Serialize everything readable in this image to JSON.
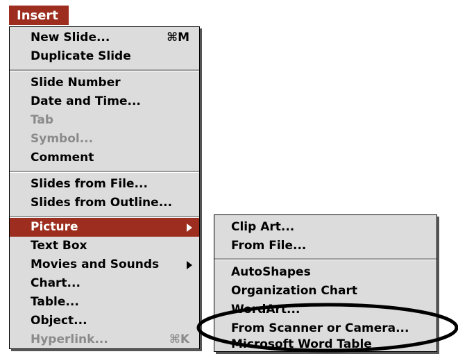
{
  "menubar": {
    "title": "Insert"
  },
  "main_menu": {
    "items": [
      {
        "label": "New Slide...",
        "shortcut": "⌘M",
        "state": "enabled"
      },
      {
        "label": "Duplicate Slide",
        "state": "enabled"
      },
      {
        "label": "Slide Number",
        "state": "enabled"
      },
      {
        "label": "Date and Time...",
        "state": "enabled"
      },
      {
        "label": "Tab",
        "state": "disabled"
      },
      {
        "label": "Symbol...",
        "state": "disabled"
      },
      {
        "label": "Comment",
        "state": "enabled"
      },
      {
        "label": "Slides from File...",
        "state": "enabled"
      },
      {
        "label": "Slides from Outline...",
        "state": "enabled"
      },
      {
        "label": "Picture",
        "state": "selected",
        "submenu": true
      },
      {
        "label": "Text Box",
        "state": "enabled"
      },
      {
        "label": "Movies and Sounds",
        "state": "enabled",
        "submenu": true
      },
      {
        "label": "Chart...",
        "state": "enabled"
      },
      {
        "label": "Table...",
        "state": "enabled"
      },
      {
        "label": "Object...",
        "state": "enabled"
      },
      {
        "label": "Hyperlink...",
        "shortcut": "⌘K",
        "state": "disabled"
      }
    ]
  },
  "picture_submenu": {
    "items": [
      {
        "label": "Clip Art...",
        "state": "enabled"
      },
      {
        "label": "From File...",
        "state": "enabled"
      },
      {
        "label": "AutoShapes",
        "state": "enabled"
      },
      {
        "label": "Organization Chart",
        "state": "enabled"
      },
      {
        "label": "WordArt...",
        "state": "enabled"
      },
      {
        "label": "From Scanner or Camera...",
        "state": "enabled",
        "highlighted_by_annotation": true
      },
      {
        "label": "Microsoft Word Table",
        "state": "enabled"
      }
    ]
  },
  "colors": {
    "menu_bg": "#dcdcdc",
    "selection": "#9c2d1f",
    "disabled_text": "#8a8a8a",
    "annotation_ellipse": "#000000"
  }
}
